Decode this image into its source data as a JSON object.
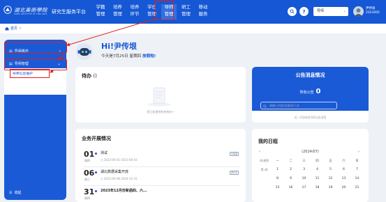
{
  "header": {
    "logo_text": "湖北美術學院",
    "logo_sub": "HUBEI INSTITUTE OF FINE ARTS",
    "platform": "研究生服务平台",
    "nav": [
      {
        "line1": "学籍",
        "line2": "管理"
      },
      {
        "line1": "培养",
        "line2": "管理"
      },
      {
        "line1": "培养",
        "line2": "环节"
      },
      {
        "line1": "学位",
        "line2": "管理"
      },
      {
        "line1": "导师",
        "line2": "管理"
      },
      {
        "line1": "研工",
        "line2": "管理"
      },
      {
        "line1": "移动",
        "line2": "服务"
      }
    ],
    "active_nav": 4,
    "role": "导师",
    "user_name": "尹传垠",
    "user_id": "2023005",
    "accent": "#1557d4",
    "highlight": "#e0201c"
  },
  "breadcrumb": {
    "home": "首页"
  },
  "sidebar": {
    "group1": "导师遴选",
    "group2": "导师管理",
    "sub_item": "导师信息维护",
    "collapse": "收起"
  },
  "welcome": {
    "greeting": "Hi!尹传垠",
    "date_text": "今天是7月25日 星期四",
    "holiday": "放假啦!"
  },
  "todo": {
    "title": "待办",
    "count": "()",
    "empty": "您已处理完所有待办~"
  },
  "business": {
    "title": "业务开展情况",
    "items": [
      {
        "day": "01",
        "week": "周四",
        "title": "测试",
        "date": "2023-06-01-2023-06-03",
        "tag": "已结束"
      },
      {
        "day": "06",
        "week": "周二",
        "title": "湖北数据采集开放",
        "date": "2023-06-06-2024-12-31",
        "tag": "进行中"
      },
      {
        "day": "31",
        "week": "周四",
        "title": "2023年12月份新函四、六...",
        "date": "",
        "tag": ""
      }
    ]
  },
  "notice": {
    "title": "公告消息情况",
    "count_label": "所有公告",
    "count": "0",
    "search_placeholder": "请输入内容/关键词/人名",
    "search_btn": "搜索",
    "empty": "近一月没有您可的公告消息"
  },
  "calendar": {
    "title": "我的日程",
    "month": "(2024/07)",
    "headers": [
      "周/星期",
      "一",
      "二",
      "三",
      "四",
      "五",
      "六",
      "日"
    ],
    "rows": [
      [
        "第1周",
        "1",
        "2",
        "3",
        "4",
        "5",
        "6",
        "7"
      ],
      [
        "",
        "8",
        "9",
        "10",
        "11",
        "12",
        "13",
        "14"
      ],
      [
        "",
        "15",
        "16",
        "17",
        "18",
        "19",
        "20",
        "21"
      ]
    ]
  }
}
